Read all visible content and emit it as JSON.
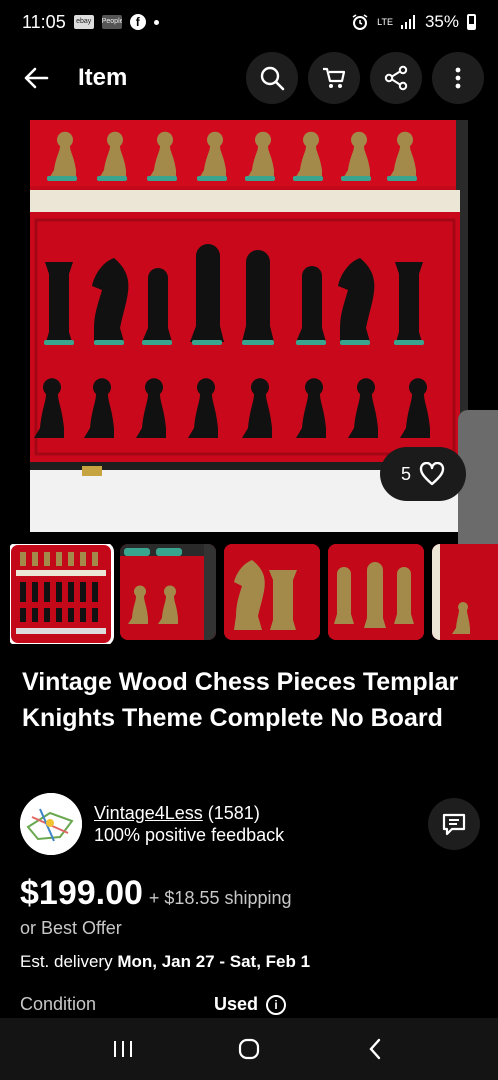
{
  "status_bar": {
    "time": "11:05",
    "app_badges": [
      "ebay",
      "People",
      "f"
    ],
    "network": "LTE",
    "battery": "35%"
  },
  "nav": {
    "title": "Item",
    "icons": [
      "back-arrow-icon",
      "search-icon",
      "cart-icon",
      "share-icon",
      "more-vertical-icon"
    ]
  },
  "hero": {
    "favorite_count": "5",
    "favorite_icon": "heart-outline-icon"
  },
  "listing": {
    "title": "Vintage Wood Chess Pieces Templar Knights Theme Complete No Board",
    "price": "$199.00",
    "shipping": "+ $18.55 shipping",
    "best_offer": "or Best Offer",
    "delivery_label": "Est. delivery",
    "delivery_dates": "Mon, Jan 27 - Sat, Feb 1",
    "condition_label": "Condition",
    "condition_value": "Used"
  },
  "seller": {
    "name": "Vintage4Less",
    "feedback_count": "(1581)",
    "feedback_text": "100% positive feedback"
  },
  "colors": {
    "background": "#000000",
    "tray_red": "#c3081a",
    "button_bg": "#1e1e1e",
    "secondary_text": "#c8c8c8"
  }
}
